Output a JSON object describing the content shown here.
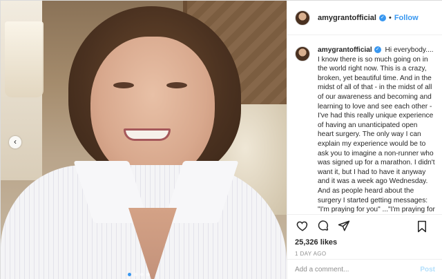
{
  "post": {
    "username": "amygrantofficial",
    "follow_label": "Follow",
    "separator": "•",
    "caption": "Hi everybody.... I know there is so much going on in the world right now. This is a crazy, broken, yet beautiful time. And in the midst of all of that - in the midst of all of our awareness and becoming and learning to love and see each other - I've had this really unique experience of having an unanticipated open heart surgery. The only way I can explain my experience would be to ask you to imagine a non-runner who was signed up for a marathon. I didn't want it, but I had to have it anyway and it was a week ago Wednesday. And as people heard about the surgery I started getting messages: \"I'm praying for you\" ...\"I'm praying for you\". People I worked with decades ago, people who have come to my concerts or listen to",
    "likes": "25,326 likes",
    "timestamp": "1 DAY AGO",
    "comment_placeholder": "Add a comment...",
    "post_label": "Post"
  },
  "carousel": {
    "slide_count": 4,
    "active_index": 0
  },
  "icons": {
    "verified": "verified-badge-icon",
    "like": "heart-icon",
    "comment": "comment-icon",
    "share": "paper-plane-icon",
    "save": "bookmark-icon",
    "prev": "chevron-left-icon"
  },
  "colors": {
    "link_blue": "#3897f0",
    "post_disabled": "#b2dffc",
    "muted_text": "#8e8e8e"
  }
}
